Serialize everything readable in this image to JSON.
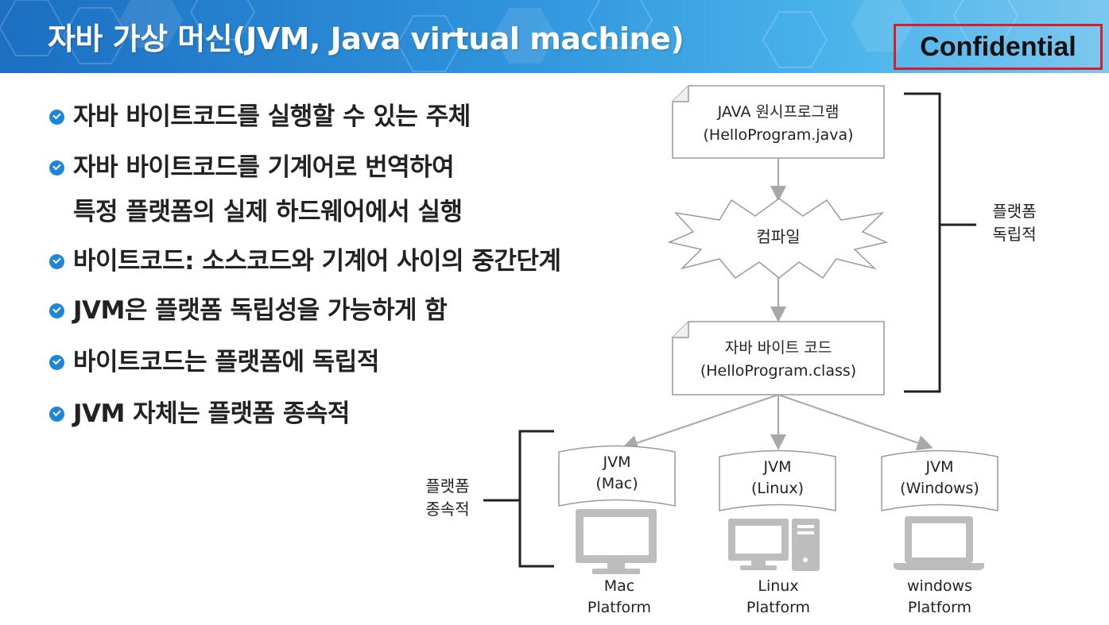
{
  "header": {
    "title": "자바 가상 머신(JVM, Java virtual machine)",
    "stamp": "Confidential"
  },
  "bullets": [
    "자바 바이트코드를 실행할 수 있는 주체",
    "자바 바이트코드를 기계어로 번역하여",
    "특정 플랫폼의 실제 하드웨어에서 실행",
    "바이트코드: 소스코드와 기계어 사이의 중간단계",
    "JVM은 플랫폼 독립성을 가능하게 함",
    "바이트코드는 플랫폼에 독립적",
    "JVM 자체는 플랫폼 종속적"
  ],
  "diagram": {
    "source_box": {
      "line1": "JAVA 원시프로그램",
      "line2": "(HelloProgram.java)"
    },
    "compile_label": "컴파일",
    "bytecode_box": {
      "line1": "자바 바이트 코드",
      "line2": "(HelloProgram.class)"
    },
    "independent_label": {
      "line1": "플랫폼",
      "line2": "독립적"
    },
    "dependent_label": {
      "line1": "플랫폼",
      "line2": "종속적"
    },
    "jvms": [
      {
        "line1": "JVM",
        "line2": "(Mac)",
        "platform1": "Mac",
        "platform2": "Platform",
        "icon": "monitor-icon"
      },
      {
        "line1": "JVM",
        "line2": "(Linux)",
        "platform1": "Linux",
        "platform2": "Platform",
        "icon": "desktop-tower-icon"
      },
      {
        "line1": "JVM",
        "line2": "(Windows)",
        "platform1": "windows",
        "platform2": "Platform",
        "icon": "laptop-icon"
      }
    ]
  },
  "colors": {
    "banner_start": "#1c6fc2",
    "banner_end": "#7cc7ef",
    "bullet": "#1e86d6",
    "stamp_border": "#d0202a",
    "icon": "#bdbdbd",
    "box_border": "#9a9a9a"
  }
}
